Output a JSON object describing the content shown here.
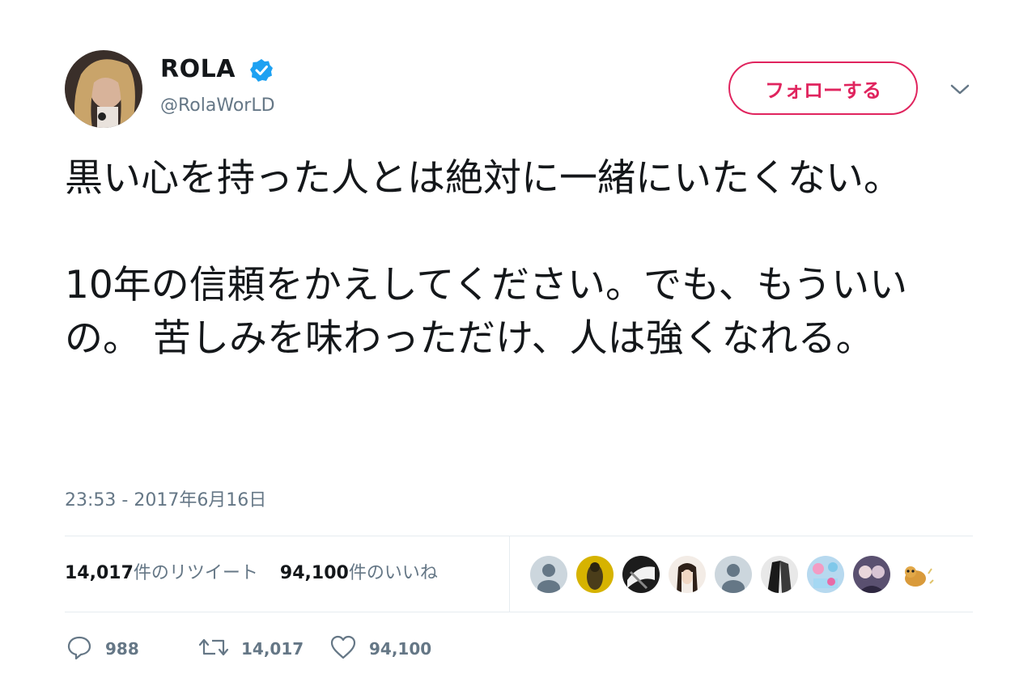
{
  "user": {
    "display_name": "ROLA",
    "handle": "@RolaWorLD",
    "verified_icon": "verified-badge-icon",
    "avatar_desc": "profile-photo"
  },
  "header": {
    "follow_label": "フォローする",
    "menu_icon": "chevron-down-icon"
  },
  "tweet": {
    "paragraph_1": "黒い心を持った人とは絶対に一緒にいたくない。",
    "paragraph_2": "10年の信頼をかえしてください。でも、もういいの。 苦しみを味わっただけ、人は強くなれる。",
    "timestamp": "23:53 - 2017年6月16日"
  },
  "stats": {
    "retweets_count": "14,017",
    "retweets_label": "件のリツイート",
    "likes_count": "94,100",
    "likes_label": "件のいいね"
  },
  "actions": {
    "reply_count": "988",
    "retweet_count": "14,017",
    "like_count": "94,100"
  },
  "colors": {
    "accent_red": "#e0245e",
    "verified_blue": "#1da1f2",
    "secondary_text": "#657786",
    "primary_text": "#14171a"
  }
}
